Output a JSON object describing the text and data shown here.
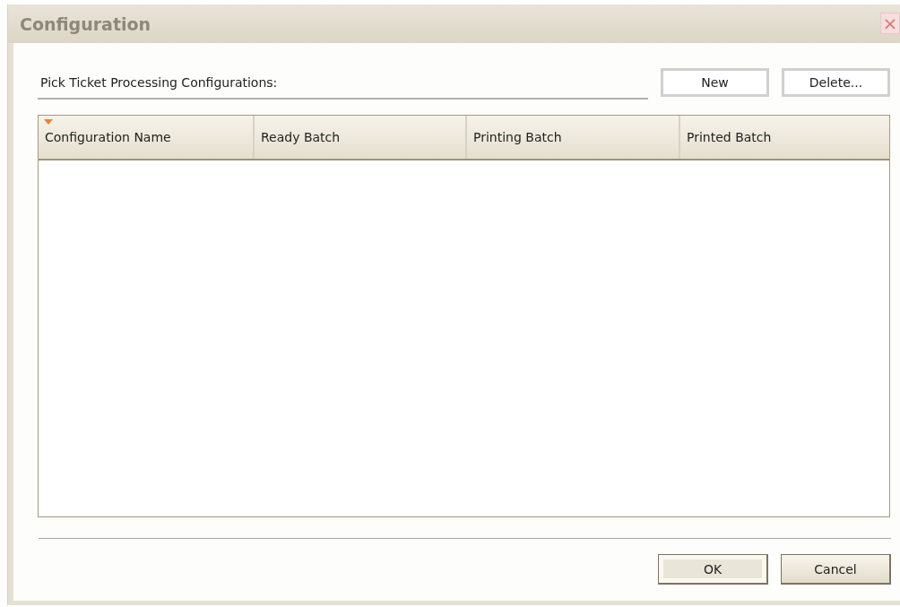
{
  "window": {
    "title": "Configuration",
    "close": "×"
  },
  "list_label": "Pick Ticket Processing Configurations:",
  "list_buttons": [
    "New",
    "Delete..."
  ],
  "table": {
    "columns": [
      {
        "label": "Configuration Name",
        "sorted": true
      },
      {
        "label": "Ready Batch",
        "sorted": false
      },
      {
        "label": "Printing Batch",
        "sorted": false
      },
      {
        "label": "Printed Batch",
        "sorted": false
      }
    ]
  },
  "dialog_buttons": [
    {
      "label": "OK",
      "default": true
    },
    {
      "label": "Cancel",
      "default": false
    }
  ]
}
